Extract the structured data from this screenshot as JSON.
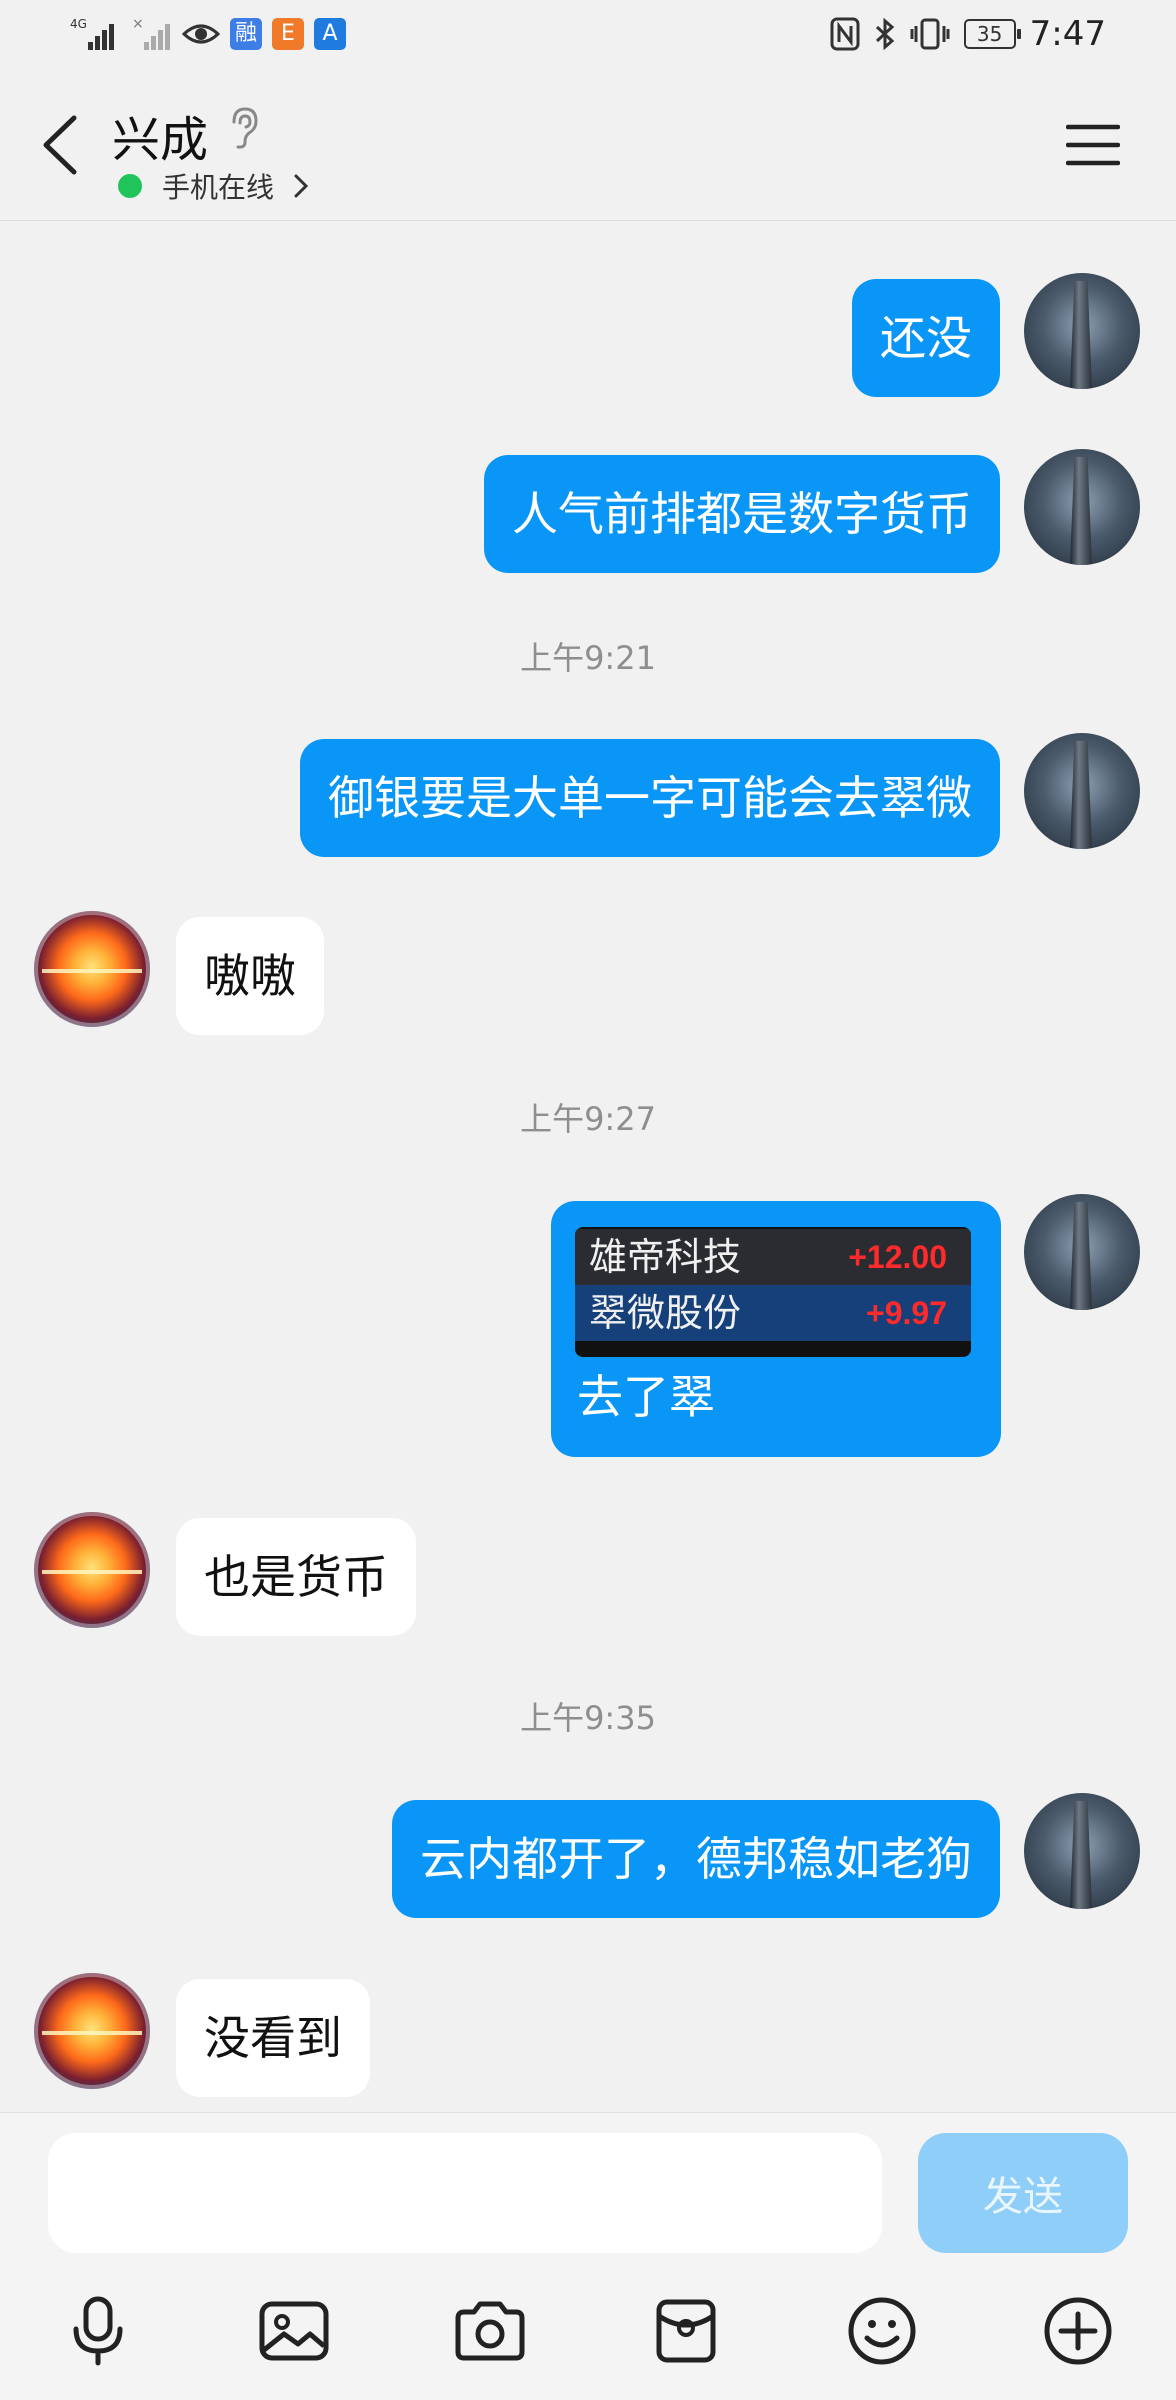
{
  "status_bar": {
    "signal1": "4G",
    "battery": "35",
    "time": "7:47",
    "app_icons": [
      "融",
      "E",
      "A"
    ]
  },
  "header": {
    "back_icon": "chevron-left-icon",
    "name": "兴成",
    "online_status": "手机在线",
    "menu_icon": "hamburger-menu-icon"
  },
  "messages": [
    {
      "side": "me",
      "text": "还没"
    },
    {
      "side": "me",
      "text": "人气前排都是数字货币"
    },
    {
      "type": "time",
      "text": "上午9:21"
    },
    {
      "side": "me",
      "text": "御银要是大单一字可能会去翠微"
    },
    {
      "side": "other",
      "text": "嗷嗷"
    },
    {
      "type": "time",
      "text": "上午9:27"
    },
    {
      "side": "me",
      "type": "image",
      "stocks": [
        {
          "name": "雄帝科技",
          "value": "+12.00"
        },
        {
          "name": "翠微股份",
          "value": "+9.97"
        }
      ],
      "caption": "去了翠"
    },
    {
      "side": "other",
      "text": "也是货币"
    },
    {
      "type": "time",
      "text": "上午9:35"
    },
    {
      "side": "me",
      "text": "云内都开了，德邦稳如老狗"
    },
    {
      "side": "other",
      "text": "没看到"
    }
  ],
  "composer": {
    "input_value": "",
    "send_label": "发送",
    "tools": [
      "microphone-icon",
      "image-icon",
      "camera-icon",
      "red-packet-icon",
      "emoji-icon",
      "plus-icon"
    ]
  },
  "colors": {
    "my_bubble": "#0a96f7",
    "other_bubble": "#ffffff",
    "online_dot": "#21c45a",
    "stock_up": "#ff2a2a",
    "send_disabled": "#8fcef8"
  }
}
